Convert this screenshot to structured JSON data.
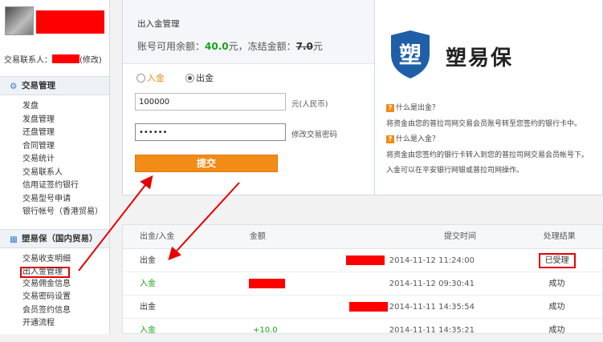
{
  "sidebar": {
    "contact_label": "交易联系人：",
    "contact_edit": "(修改)",
    "sections": [
      {
        "title": "交易管理",
        "items": [
          "发盘",
          "发盘管理",
          "还盘管理",
          "合同管理",
          "交易统计",
          "交易联系人",
          "信用证签约银行",
          "交易型号申请",
          "银行帐号（香港贸易）"
        ]
      },
      {
        "title": "塑易保（国内贸易）",
        "items": [
          "交易收支明细",
          "出入金管理",
          "交易佣金信息",
          "交易密码设置",
          "会员签约信息",
          "开通流程"
        ]
      }
    ],
    "active_item": "出入金管理"
  },
  "form": {
    "title": "出入金管理",
    "balance_label": "账号可用余额：",
    "balance_value": "40.0",
    "balance_unit": "元，冻结金额：",
    "frozen_value": "7.0",
    "frozen_unit": "元",
    "radio_in": "入金",
    "radio_out": "出金",
    "selected": "出金",
    "amount_value": "100000",
    "amount_hint": "元(人民币)",
    "password_value": "••••••",
    "password_hint": "修改交易密码",
    "submit_label": "提交"
  },
  "brand": {
    "logo_char": "塑",
    "name": "塑易保",
    "faq": [
      {
        "q": "什么是出金？",
        "a": "将资金由您的普拉司网交易会员账号转至您签约的银行卡中。"
      },
      {
        "q": "什么是入金？",
        "a": "将资金由您签约的银行卡转入到您的普拉司网交易会员帐号下。",
        "a2": "入金可以在平安银行网银或普拉司网操作。"
      }
    ],
    "q_icon": "?"
  },
  "table": {
    "headers": [
      "出金/入金",
      "金额",
      "提交时间",
      "处理结果"
    ],
    "rows": [
      {
        "type": "出金",
        "time": "2014-11-12 11:24:00",
        "status": "已受理",
        "highlight": true,
        "green": false
      },
      {
        "type": "入金",
        "time": "2014-11-12 09:30:41",
        "status": "成功",
        "highlight": false,
        "green": true
      },
      {
        "type": "出金",
        "time": "2014-11-11 14:35:54",
        "status": "成功",
        "highlight": false,
        "green": false
      },
      {
        "type": "入金",
        "time": "2014-11-11 14:35:21",
        "amount": "+10.0",
        "status": "成功",
        "highlight": false,
        "green": true
      }
    ]
  },
  "colors": {
    "accent": "#f28b18",
    "green": "#18a318",
    "red": "#ff0000",
    "brand_blue": "#1f5fa8"
  }
}
